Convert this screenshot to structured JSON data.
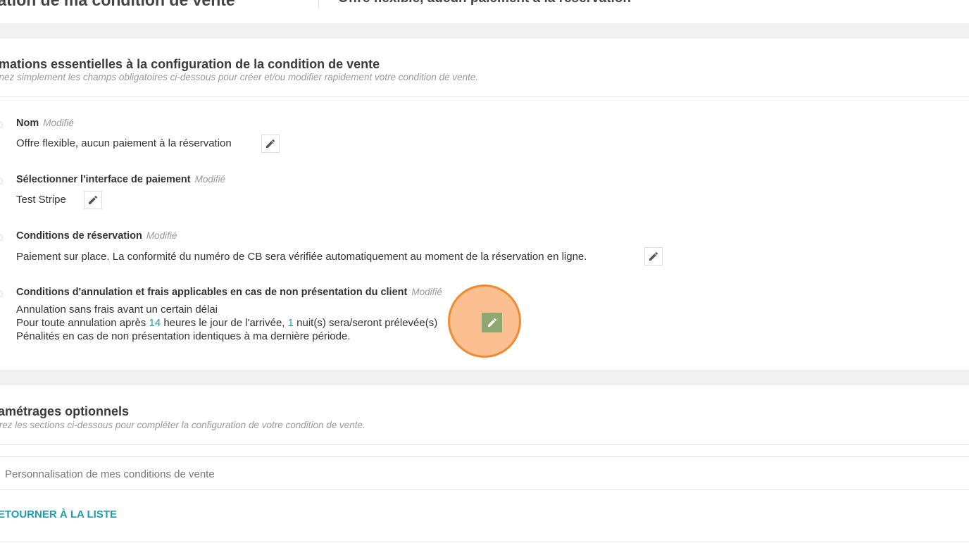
{
  "header": {
    "title": "Création de ma condition de vente",
    "subtitle": "Offre flexible, aucun paiement à la réservation"
  },
  "essentials": {
    "title": "Informations essentielles à la configuration de la condition de vente",
    "description": "Renseignez simplement les champs obligatoires ci-dessous pour créer et/ou modifier rapidement votre condition de vente.",
    "fields": [
      {
        "label": "Nom",
        "status": "Modifié",
        "value": "Offre flexible, aucun paiement à la réservation"
      },
      {
        "label": "Sélectionner l'interface de paiement",
        "status": "Modifié",
        "value": "Test Stripe"
      },
      {
        "label": "Conditions de réservation",
        "status": "Modifié",
        "value": "Paiement sur place. La conformité du numéro de CB sera vérifiée automatiquement au moment de la réservation en ligne."
      },
      {
        "label": "Conditions d'annulation et frais applicables en cas de non présentation du client",
        "status": "Modifié",
        "line1": "Annulation sans frais avant un certain délai",
        "line2_a": "Pour toute annulation après",
        "hours": "14",
        "line2_b": "heures le jour de l'arrivée,",
        "nights": "1",
        "line2_c": "nuit(s) sera/seront prélevée(s)",
        "line3": "Pénalités en cas de non présentation identiques à ma dernière période."
      }
    ]
  },
  "optional": {
    "title": "Paramétrages optionnels",
    "description": "Parcourez les sections ci-dessous pour compléter la configuration de votre condition de vente.",
    "sections": [
      {
        "label": "Personnalisation de mes conditions de vente"
      }
    ]
  },
  "footer": {
    "back_link": "RETOURNER À LA LISTE"
  },
  "colors": {
    "accent": "#1aa3b8",
    "highlight": "#f08a30",
    "edit_active": "#8fa873"
  }
}
